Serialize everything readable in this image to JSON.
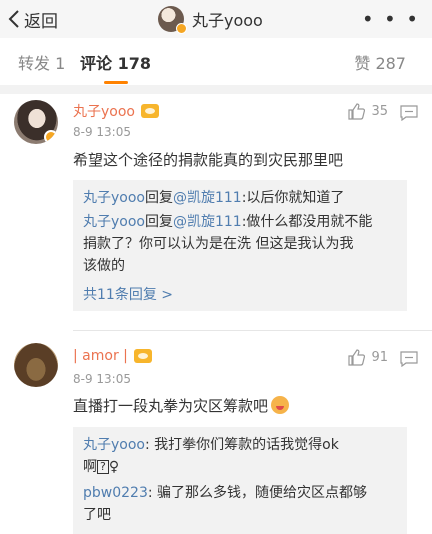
{
  "nav": {
    "back_label": "返回",
    "title": "丸子yooo",
    "more": "• • •"
  },
  "tabs": {
    "repost": "转发 1",
    "comment": "评论 178",
    "like": "赞 287"
  },
  "colors": {
    "accent": "#ff8200",
    "username": "#eb7350",
    "link": "#507daf"
  },
  "comments": [
    {
      "username": "丸子yooo",
      "time": "8-9 13:05",
      "text": "希望这个途径的捐款能真的到灾民那里吧",
      "likes": "35",
      "replies": [
        {
          "user": "丸子yooo",
          "reply_word": "回复",
          "mention": "@凯旋111",
          "text": ":以后你就知道了"
        },
        {
          "user": "丸子yooo",
          "reply_word": "回复",
          "mention": "@凯旋111",
          "text_line1": ":做什么都没用就不能",
          "text_line2": "捐款了？你可以认为是在洗 但这是我认为我",
          "text_line3": "该做的"
        }
      ],
      "total_replies": "共11条回复 >"
    },
    {
      "username": "| amor |",
      "time": "8-9 13:05",
      "text": "直播打一段丸拳为灾区筹款吧",
      "likes": "91",
      "replies": [
        {
          "user": "丸子yooo",
          "text_line1": ": 我打拳你们筹款的话我觉得ok",
          "text_line2a": "啊",
          "text_line2b": "?",
          "text_line2c": "♀"
        },
        {
          "user": "pbw0223",
          "text_line1": ": 骗了那么多钱，随便给灾区点都够",
          "text_line2": "了吧"
        }
      ]
    }
  ]
}
